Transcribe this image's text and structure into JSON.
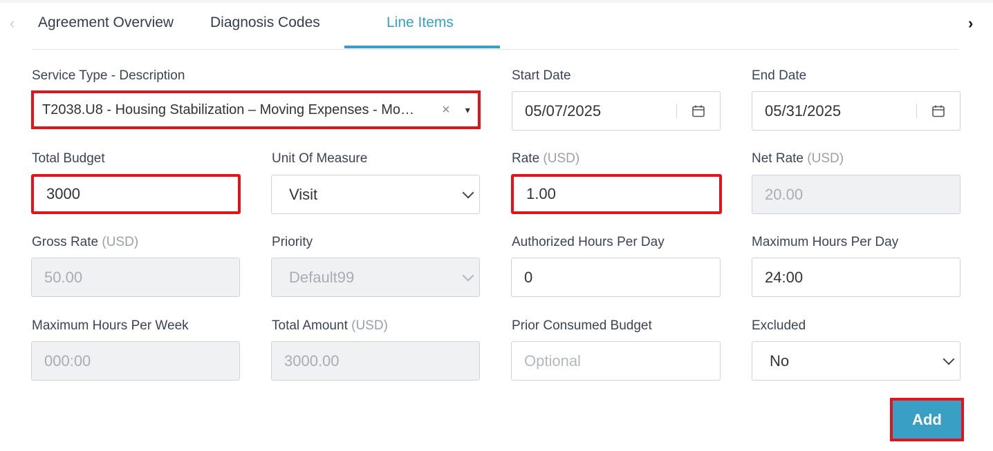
{
  "tabs": [
    {
      "label": "Agreement Overview"
    },
    {
      "label": "Diagnosis Codes"
    },
    {
      "label": "Line Items"
    }
  ],
  "nav": {
    "prev": "‹",
    "next": "›"
  },
  "service_type": {
    "label": "Service Type - Description",
    "value": "T2038.U8 - Housing Stabilization – Moving Expenses - Mo…",
    "clear": "×",
    "caret": "▾"
  },
  "start_date": {
    "label": "Start Date",
    "value": "05/07/2025",
    "icon": "calendar-icon"
  },
  "end_date": {
    "label": "End Date",
    "value": "05/31/2025",
    "icon": "calendar-icon"
  },
  "total_budget": {
    "label": "Total Budget",
    "value": "3000"
  },
  "unit_of_measure": {
    "label": "Unit Of Measure",
    "value": "Visit"
  },
  "rate": {
    "label": "Rate",
    "unit": "(USD)",
    "value": "1.00"
  },
  "net_rate": {
    "label": "Net Rate",
    "unit": "(USD)",
    "value": "20.00"
  },
  "gross_rate": {
    "label": "Gross Rate",
    "unit": "(USD)",
    "value": "50.00"
  },
  "priority": {
    "label": "Priority",
    "value": "Default99"
  },
  "authorized_hours": {
    "label": "Authorized Hours Per Day",
    "value": "0"
  },
  "max_hours_day": {
    "label": "Maximum Hours Per Day",
    "value": "24:00"
  },
  "max_hours_week": {
    "label": "Maximum Hours Per Week",
    "value": "000:00"
  },
  "total_amount": {
    "label": "Total Amount",
    "unit": "(USD)",
    "value": "3000.00"
  },
  "prior_consumed": {
    "label": "Prior Consumed Budget",
    "placeholder": "Optional"
  },
  "excluded": {
    "label": "Excluded",
    "value": "No"
  },
  "add_button": {
    "label": "Add"
  },
  "colors": {
    "accent": "#3a9fc4",
    "highlight": "#e3131a",
    "disabled_bg": "#f0f1f3"
  }
}
